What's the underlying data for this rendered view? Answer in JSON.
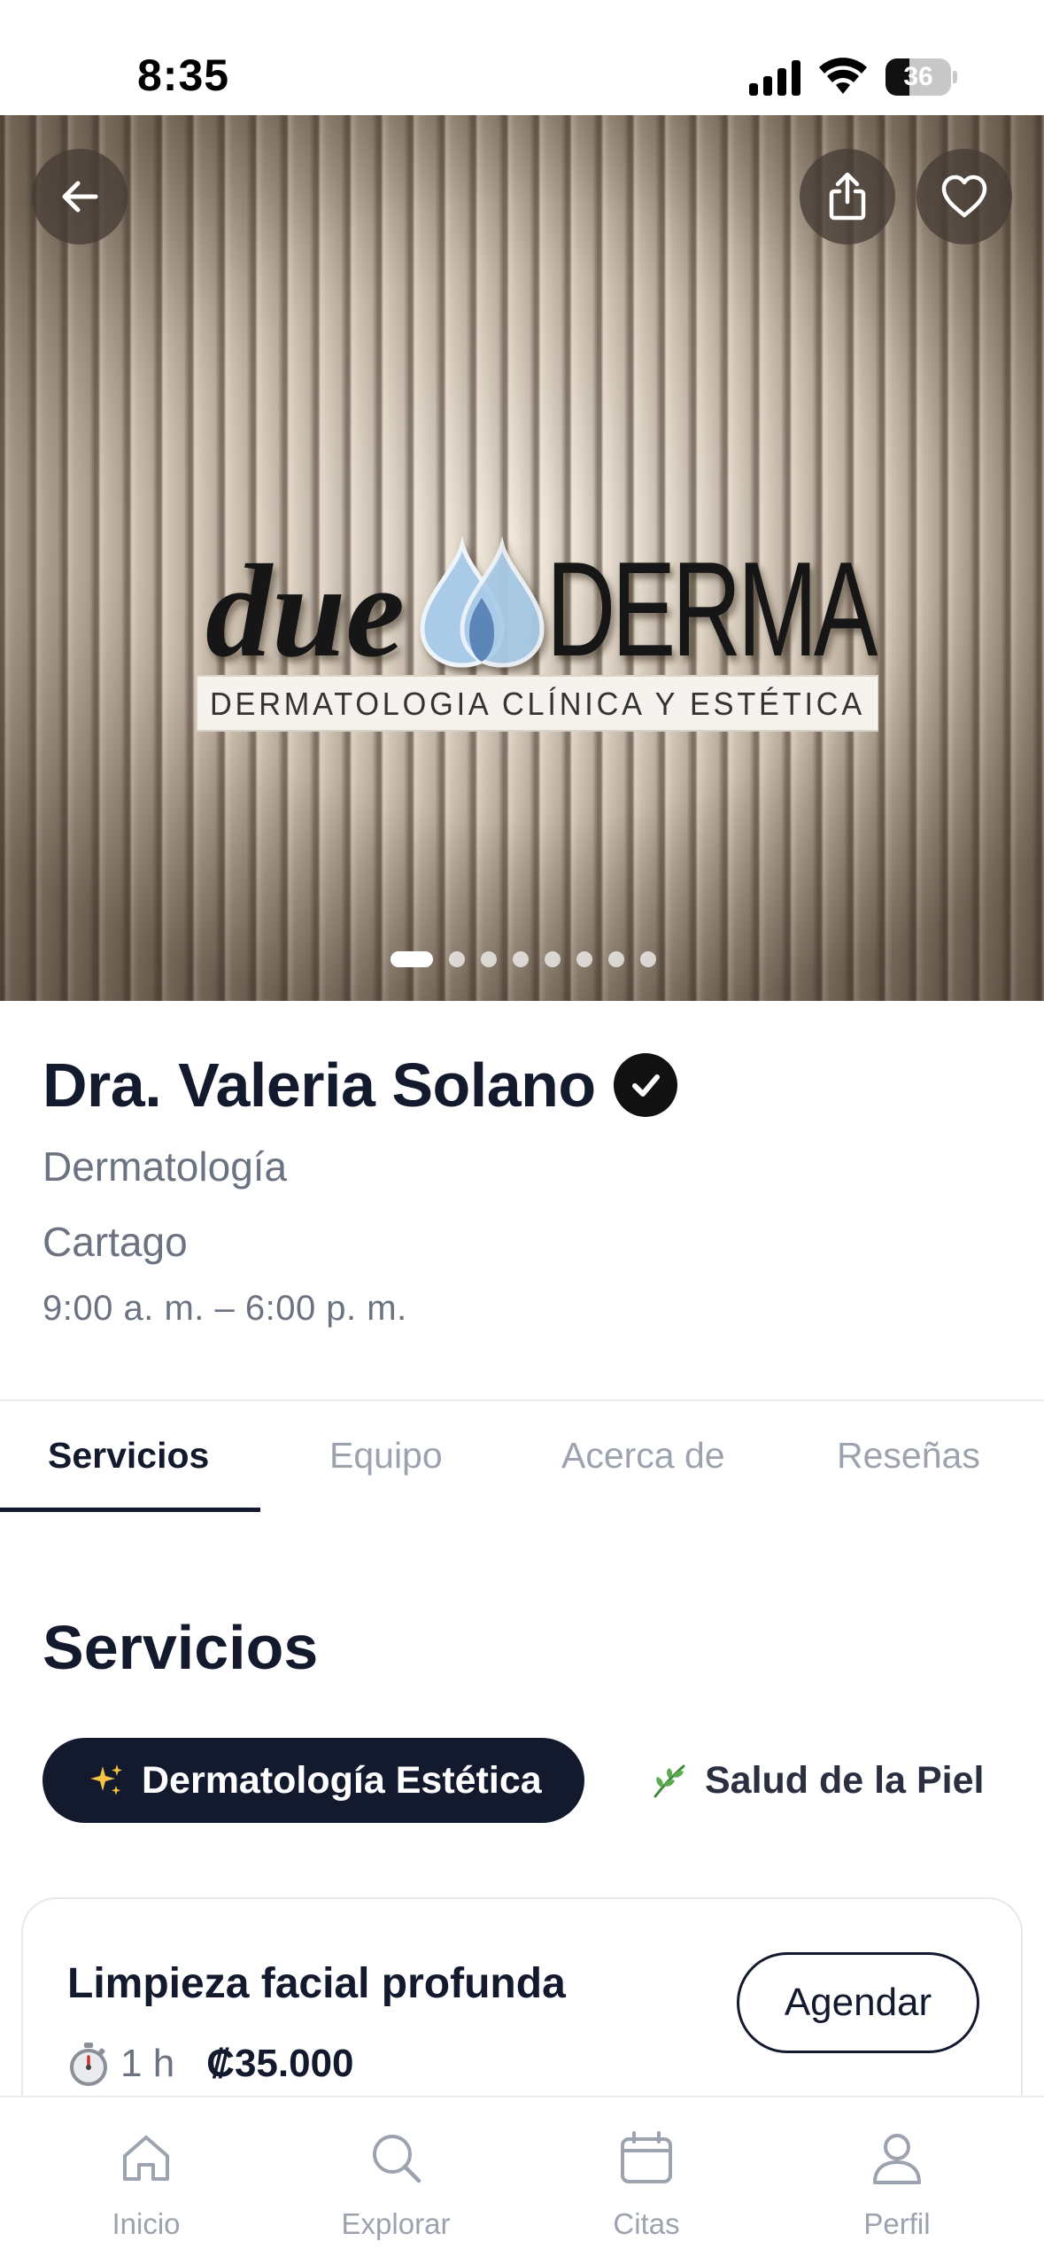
{
  "status_bar": {
    "time": "8:35",
    "battery": "36",
    "battery_level": 0.36
  },
  "hero": {
    "logo_text": "dueDERMA",
    "logo_subtitle": "DERMATOLOGIA CLÍNICA Y ESTÉTICA",
    "carousel_total": 8,
    "carousel_active_index": 0
  },
  "profile": {
    "name": "Dra. Valeria Solano",
    "specialty": "Dermatología",
    "city": "Cartago",
    "hours": "9:00 a. m. – 6:00 p. m."
  },
  "tabs": [
    {
      "label": "Servicios",
      "active": true
    },
    {
      "label": "Equipo",
      "active": false
    },
    {
      "label": "Acerca de",
      "active": false
    },
    {
      "label": "Reseñas",
      "active": false
    }
  ],
  "services": {
    "title": "Servicios",
    "categories": [
      {
        "label": "Dermatología Estética",
        "icon": "sparkles-icon",
        "active": true
      },
      {
        "label": "Salud de la Piel",
        "icon": "herb-icon",
        "active": false
      }
    ],
    "items": [
      {
        "name": "Limpieza facial profunda",
        "duration": "1 h",
        "price": "₡35.000",
        "action": "Agendar"
      }
    ]
  },
  "bottom_nav": [
    {
      "label": "Inicio",
      "icon": "home-icon"
    },
    {
      "label": "Explorar",
      "icon": "search-icon"
    },
    {
      "label": "Citas",
      "icon": "calendar-icon"
    },
    {
      "label": "Perfil",
      "icon": "user-icon"
    }
  ],
  "colors": {
    "primary": "#141a2e",
    "muted": "#6b7280",
    "inactive": "#9ca3af",
    "logo_drop": "#a9cbe8"
  }
}
